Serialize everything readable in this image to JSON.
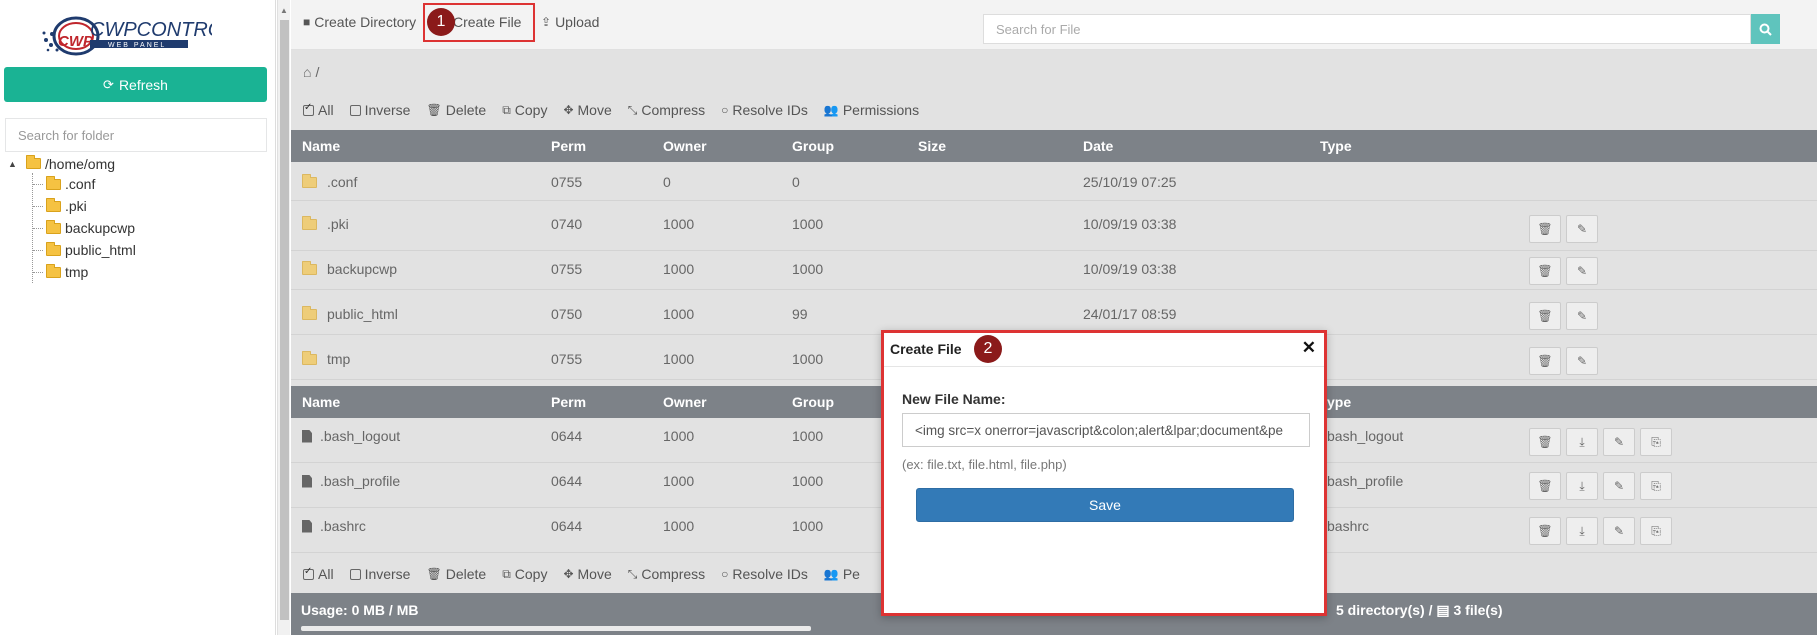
{
  "sidebar": {
    "logo_text": "CWPCONTROL",
    "logo_sub": "WEB PANEL",
    "refresh_label": "Refresh",
    "search_placeholder": "Search for folder",
    "tree_root": "/home/omg",
    "tree_items": [
      ".conf",
      ".pki",
      "backupcwp",
      "public_html",
      "tmp"
    ]
  },
  "toolbar": {
    "create_directory": "Create Directory",
    "create_file": "Create File",
    "upload": "Upload",
    "search_placeholder": "Search for File"
  },
  "breadcrumb": {
    "path": "/"
  },
  "actions": {
    "all": "All",
    "inverse": "Inverse",
    "delete": "Delete",
    "copy": "Copy",
    "move": "Move",
    "compress": "Compress",
    "resolve_ids": "Resolve IDs",
    "permissions": "Permissions"
  },
  "table": {
    "columns": [
      "Name",
      "Perm",
      "Owner",
      "Group",
      "Size",
      "Date",
      "Type"
    ],
    "directories": [
      {
        "name": ".conf",
        "perm": "0755",
        "owner": "0",
        "group": "0",
        "date": "25/10/19 07:25"
      },
      {
        "name": ".pki",
        "perm": "0740",
        "owner": "1000",
        "group": "1000",
        "date": "10/09/19 03:38"
      },
      {
        "name": "backupcwp",
        "perm": "0755",
        "owner": "1000",
        "group": "1000",
        "date": "10/09/19 03:38"
      },
      {
        "name": "public_html",
        "perm": "0750",
        "owner": "1000",
        "group": "99",
        "date": "24/01/17 08:59"
      },
      {
        "name": "tmp",
        "perm": "0755",
        "owner": "1000",
        "group": "1000",
        "date": ""
      }
    ],
    "file_columns": [
      "Name",
      "Perm",
      "Owner",
      "Group",
      "ype"
    ],
    "files": [
      {
        "name": ".bash_logout",
        "perm": "0644",
        "owner": "1000",
        "group": "1000",
        "type": "bash_logout"
      },
      {
        "name": ".bash_profile",
        "perm": "0644",
        "owner": "1000",
        "group": "1000",
        "type": "bash_profile"
      },
      {
        "name": ".bashrc",
        "perm": "0644",
        "owner": "1000",
        "group": "1000",
        "type": "bashrc"
      }
    ]
  },
  "bottom_actions": {
    "all": "All",
    "inverse": "Inverse",
    "delete": "Delete",
    "copy": "Copy",
    "move": "Move",
    "compress": "Compress",
    "resolve_ids": "Resolve IDs",
    "permissions_partial": "Pe"
  },
  "footer": {
    "usage": "Usage: 0 MB / MB",
    "summary_dirs": "5 directory(s) /",
    "summary_files": "3 file(s)"
  },
  "modal": {
    "title": "Create File",
    "label": "New File Name:",
    "input_value": "<img src=x onerror=javascript&colon;alert&lpar;document&pe",
    "hint": "(ex: file.txt, file.html, file.php)",
    "save_label": "Save"
  },
  "annotations": {
    "step1": "1",
    "step2": "2"
  },
  "colors": {
    "accent": "#1ab394",
    "header": "#7d8288",
    "primary": "#337ab7",
    "highlight": "#dd3333",
    "badge": "#8b1a1a"
  }
}
